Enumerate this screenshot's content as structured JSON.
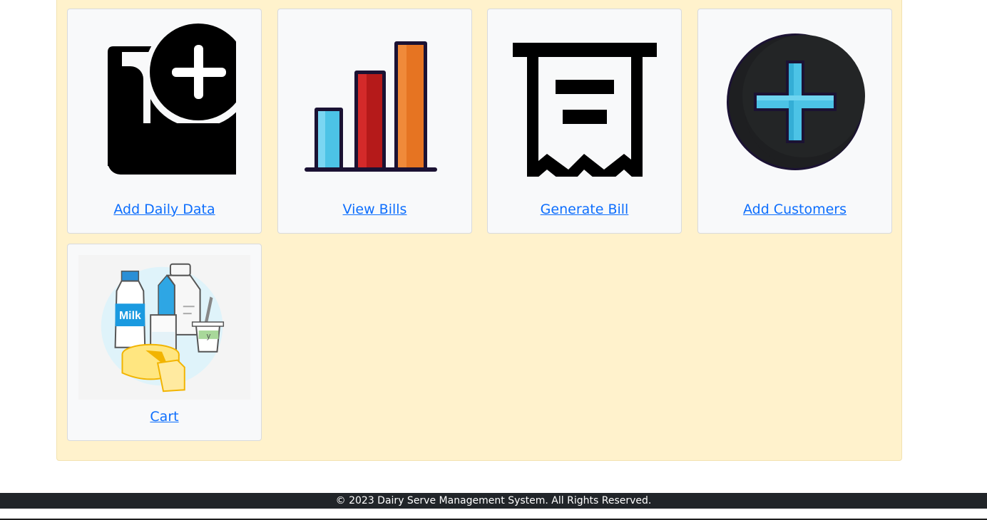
{
  "cards": [
    {
      "label": "Add Daily Data",
      "icon": "database-add-icon"
    },
    {
      "label": "View Bills",
      "icon": "bar-chart-icon"
    },
    {
      "label": "Generate Bill",
      "icon": "receipt-icon"
    },
    {
      "label": "Add Customers",
      "icon": "plus-circle-icon"
    },
    {
      "label": "Cart",
      "icon": "dairy-products-icon",
      "icon_text": [
        "Milk",
        "y"
      ]
    }
  ],
  "footer": {
    "text": "© 2023 Dairy Serve Management System. All Rights Reserved."
  },
  "colors": {
    "panel": "#fff2cc",
    "link": "#0d6efd",
    "footer": "#212529"
  }
}
